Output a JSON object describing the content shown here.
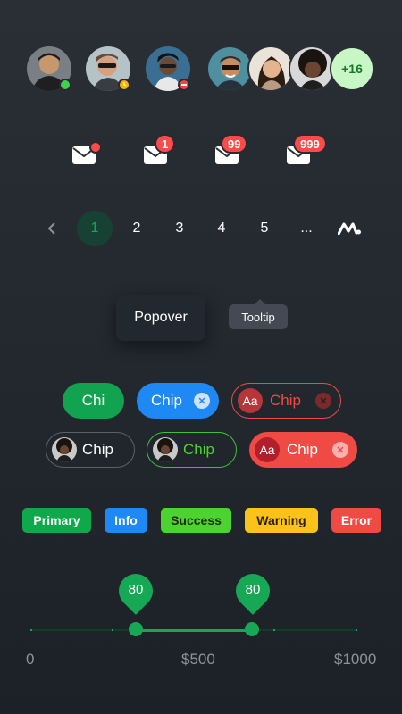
{
  "avatars": {
    "status_avatars": [
      {
        "status": "online",
        "color": "#3fd24a"
      },
      {
        "status": "away",
        "color": "#f7b500"
      },
      {
        "status": "busy",
        "color": "#f0453d"
      }
    ],
    "group_more_count": "+16"
  },
  "notifications": {
    "badges": [
      "",
      "1",
      "99",
      "999"
    ]
  },
  "pagination": {
    "prev_icon": "chevron-left-icon",
    "pages": [
      "1",
      "2",
      "3",
      "4",
      "5"
    ],
    "current": "1",
    "ellipsis": "...",
    "logo_icon": "m-logo-icon"
  },
  "overlays": {
    "popover": "Popover",
    "tooltip": "Tooltip"
  },
  "chips": {
    "row1": [
      {
        "label": "Chi",
        "style": "filled-green"
      },
      {
        "label": "Chip",
        "style": "filled-blue",
        "deletable": true
      },
      {
        "label": "Chip",
        "style": "outlined-red",
        "avatar_text": "Aa",
        "deletable": true
      }
    ],
    "row2": [
      {
        "label": "Chip",
        "style": "outlined-grey",
        "avatar": "photo"
      },
      {
        "label": "Chip",
        "style": "outlined-green",
        "avatar": "photo"
      },
      {
        "label": "Chip",
        "style": "filled-red",
        "avatar_text": "Aa",
        "deletable": true
      }
    ]
  },
  "labels": [
    {
      "text": "Primary",
      "bg": "#0fa84a",
      "fg": "#ffffff"
    },
    {
      "text": "Info",
      "bg": "#1e88f5",
      "fg": "#ffffff"
    },
    {
      "text": "Success",
      "bg": "#4cd32f",
      "fg": "#1c2a10"
    },
    {
      "text": "Warning",
      "bg": "#fbc21a",
      "fg": "#2a2000"
    },
    {
      "text": "Error",
      "bg": "#f04a45",
      "fg": "#ffffff"
    }
  ],
  "slider": {
    "low_value": "80",
    "high_value": "80",
    "scale": [
      "0",
      "$500",
      "$1000"
    ],
    "accent": "#17a856"
  }
}
